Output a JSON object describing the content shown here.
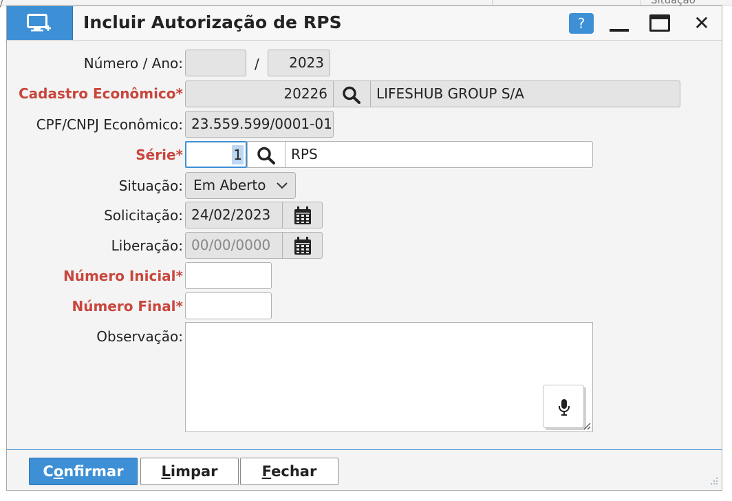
{
  "background": {
    "slash": "/",
    "clipped_text": "Situação"
  },
  "window": {
    "title": "Incluir Autorização de RPS",
    "help_label": "?",
    "icon": "monitor-add-icon",
    "accent_color": "#3d8fd6",
    "required_color": "#c9463d"
  },
  "form": {
    "numero_ano": {
      "label": "Número / Ano:",
      "numero": "",
      "separator": "/",
      "ano": "2023"
    },
    "cadastro": {
      "label": "Cadastro Econômico*",
      "codigo": "20226",
      "nome": "LIFESHUB GROUP S/A",
      "search_icon": "search-icon"
    },
    "cpf_cnpj": {
      "label": "CPF/CNPJ Econômico:",
      "value": "23.559.599/0001-01"
    },
    "serie": {
      "label": "Série*",
      "codigo": "1",
      "descricao": "RPS",
      "search_icon": "search-icon"
    },
    "situacao": {
      "label": "Situação:",
      "selected": "Em Aberto"
    },
    "solicitacao": {
      "label": "Solicitação:",
      "value": "24/02/2023",
      "icon": "calendar-icon"
    },
    "liberacao": {
      "label": "Liberação:",
      "value": "00/00/0000",
      "icon": "calendar-icon"
    },
    "numero_inicial": {
      "label": "Número Inicial*",
      "value": ""
    },
    "numero_final": {
      "label": "Número Final*",
      "value": ""
    },
    "observacao": {
      "label": "Observação:",
      "value": "",
      "mic_icon": "microphone-icon"
    }
  },
  "footer": {
    "confirmar": {
      "first": "C",
      "underline": "o",
      "rest": "nfirmar"
    },
    "limpar": {
      "first": "",
      "underline": "L",
      "rest": "impar"
    },
    "fechar": {
      "first": "",
      "underline": "F",
      "rest": "echar"
    }
  }
}
